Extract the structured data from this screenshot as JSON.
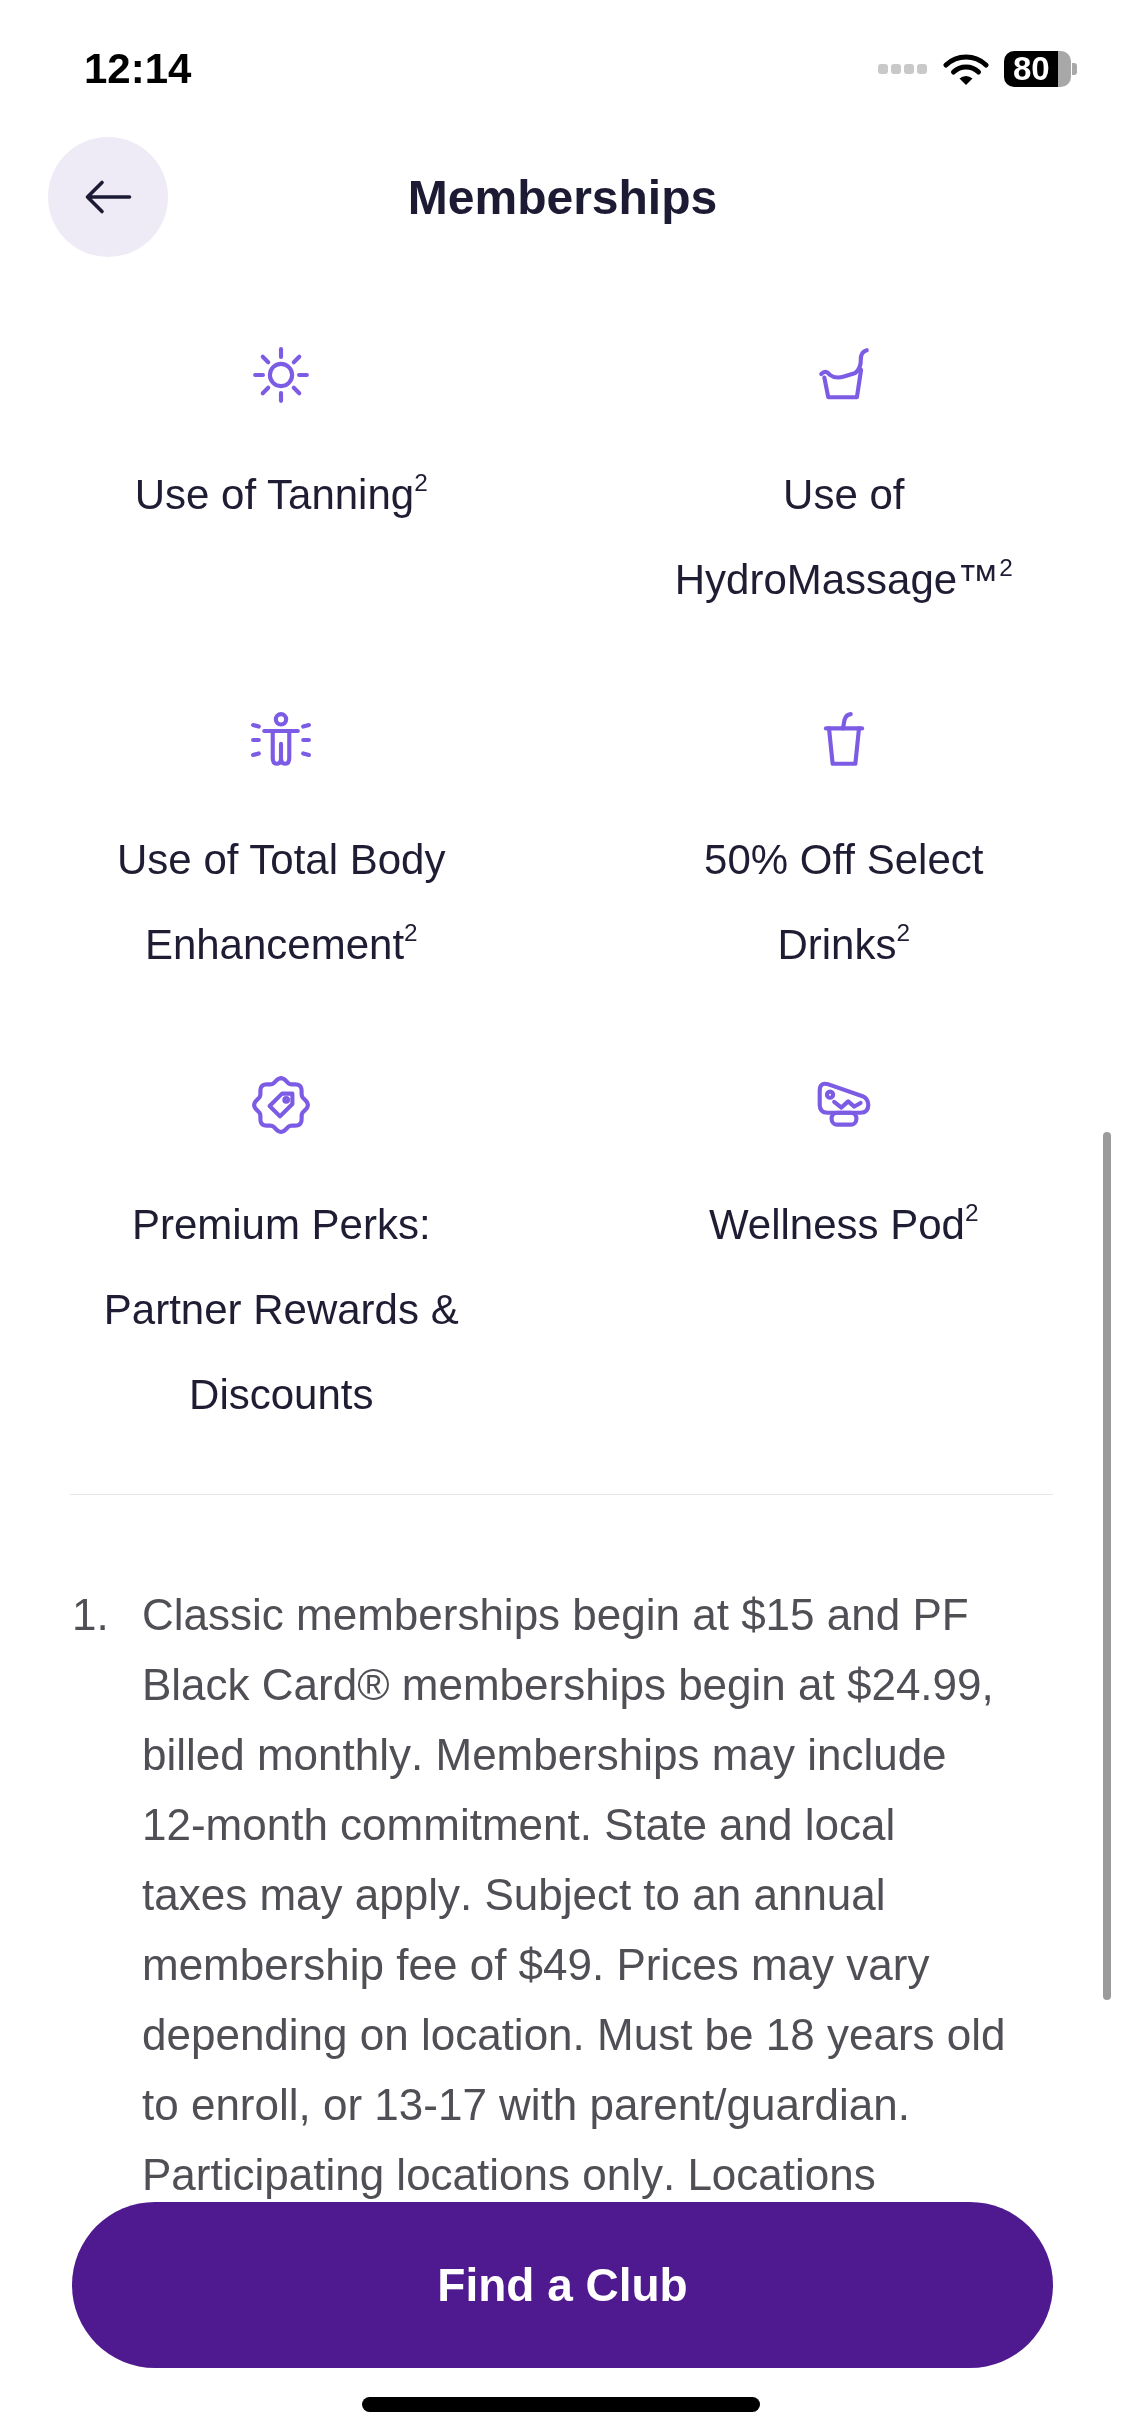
{
  "status_bar": {
    "time": "12:14",
    "battery": "80"
  },
  "header": {
    "title": "Memberships"
  },
  "features": [
    {
      "kind": "sun",
      "label": "Use of Tanning$^{2}$"
    },
    {
      "kind": "chair",
      "label": "Use of HydroMassage™$^{2}$"
    },
    {
      "kind": "body",
      "label": "Use of Total Body Enhancement$^{2}$"
    },
    {
      "kind": "cup",
      "label": "50% Off Select Drinks$^{2}$"
    },
    {
      "kind": "tag",
      "label": "Premium Perks: Partner Rewards & Discounts"
    },
    {
      "kind": "pod",
      "label": "Wellness Pod$^{2}$"
    }
  ],
  "footnote": {
    "number": "1.",
    "text": "Classic memberships begin at $15 and PF Black Card® memberships begin at $24.99, billed monthly. Memberships may include 12-month commitment. State and local taxes may apply. Subject to an annual membership fee of $49. Prices may vary depending on location. Must be 18 years old to enroll, or 13-17 with parent/guardian.",
    "cut_line": "Participating locations only. Locations"
  },
  "footer": {
    "button": "Find a Club"
  }
}
